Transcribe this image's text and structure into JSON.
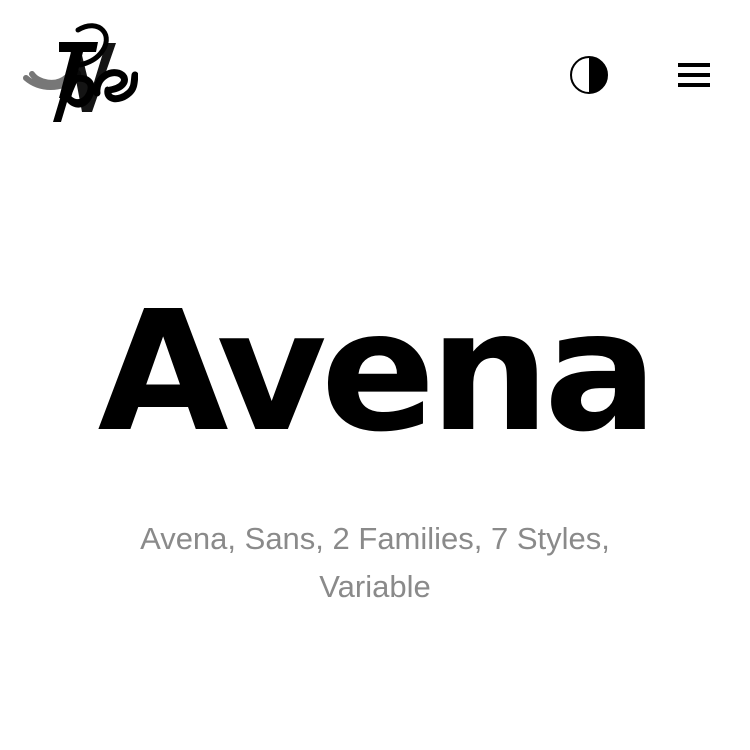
{
  "header": {
    "logo_icon": "type-logo",
    "theme_toggle_icon": "contrast-icon",
    "menu_icon": "hamburger-menu-icon"
  },
  "hero": {
    "title": "Avena",
    "subtitle": "Avena, Sans, 2 Families, 7 Styles, Variable"
  },
  "colors": {
    "background": "#ffffff",
    "text": "#000000",
    "subtitle": "#8a8a8a"
  }
}
